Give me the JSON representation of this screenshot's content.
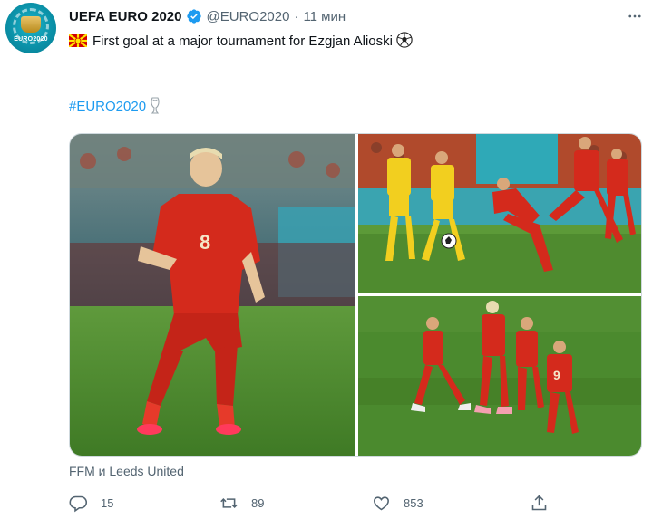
{
  "account": {
    "display_name": "UEFA EURO 2020",
    "handle": "@EURO2020",
    "separator": "·",
    "time": "11 мин",
    "avatar_text": "EURO2020"
  },
  "tweet": {
    "text": "First goal at a major tournament for Ezgjan Alioski",
    "hashtag": "#EURO2020"
  },
  "media": {
    "caption": "FFM и Leeds United"
  },
  "actions": {
    "reply_count": "15",
    "retweet_count": "89",
    "like_count": "853"
  },
  "colors": {
    "accent": "#1d9bf0",
    "secondary_text": "#536471",
    "primary_text": "#0f1419",
    "verified": "#1d9bf0",
    "kit_red": "#d42a1c",
    "kit_yellow": "#f2cf1f",
    "pitch": "#4f8b2f"
  },
  "icons": {
    "verified": "verified-badge-icon",
    "more": "more-icon",
    "flag": "north-macedonia-flag-icon",
    "ball": "soccer-ball-icon",
    "trophy": "trophy-icon",
    "reply": "reply-icon",
    "retweet": "retweet-icon",
    "like": "heart-icon",
    "share": "share-icon"
  }
}
